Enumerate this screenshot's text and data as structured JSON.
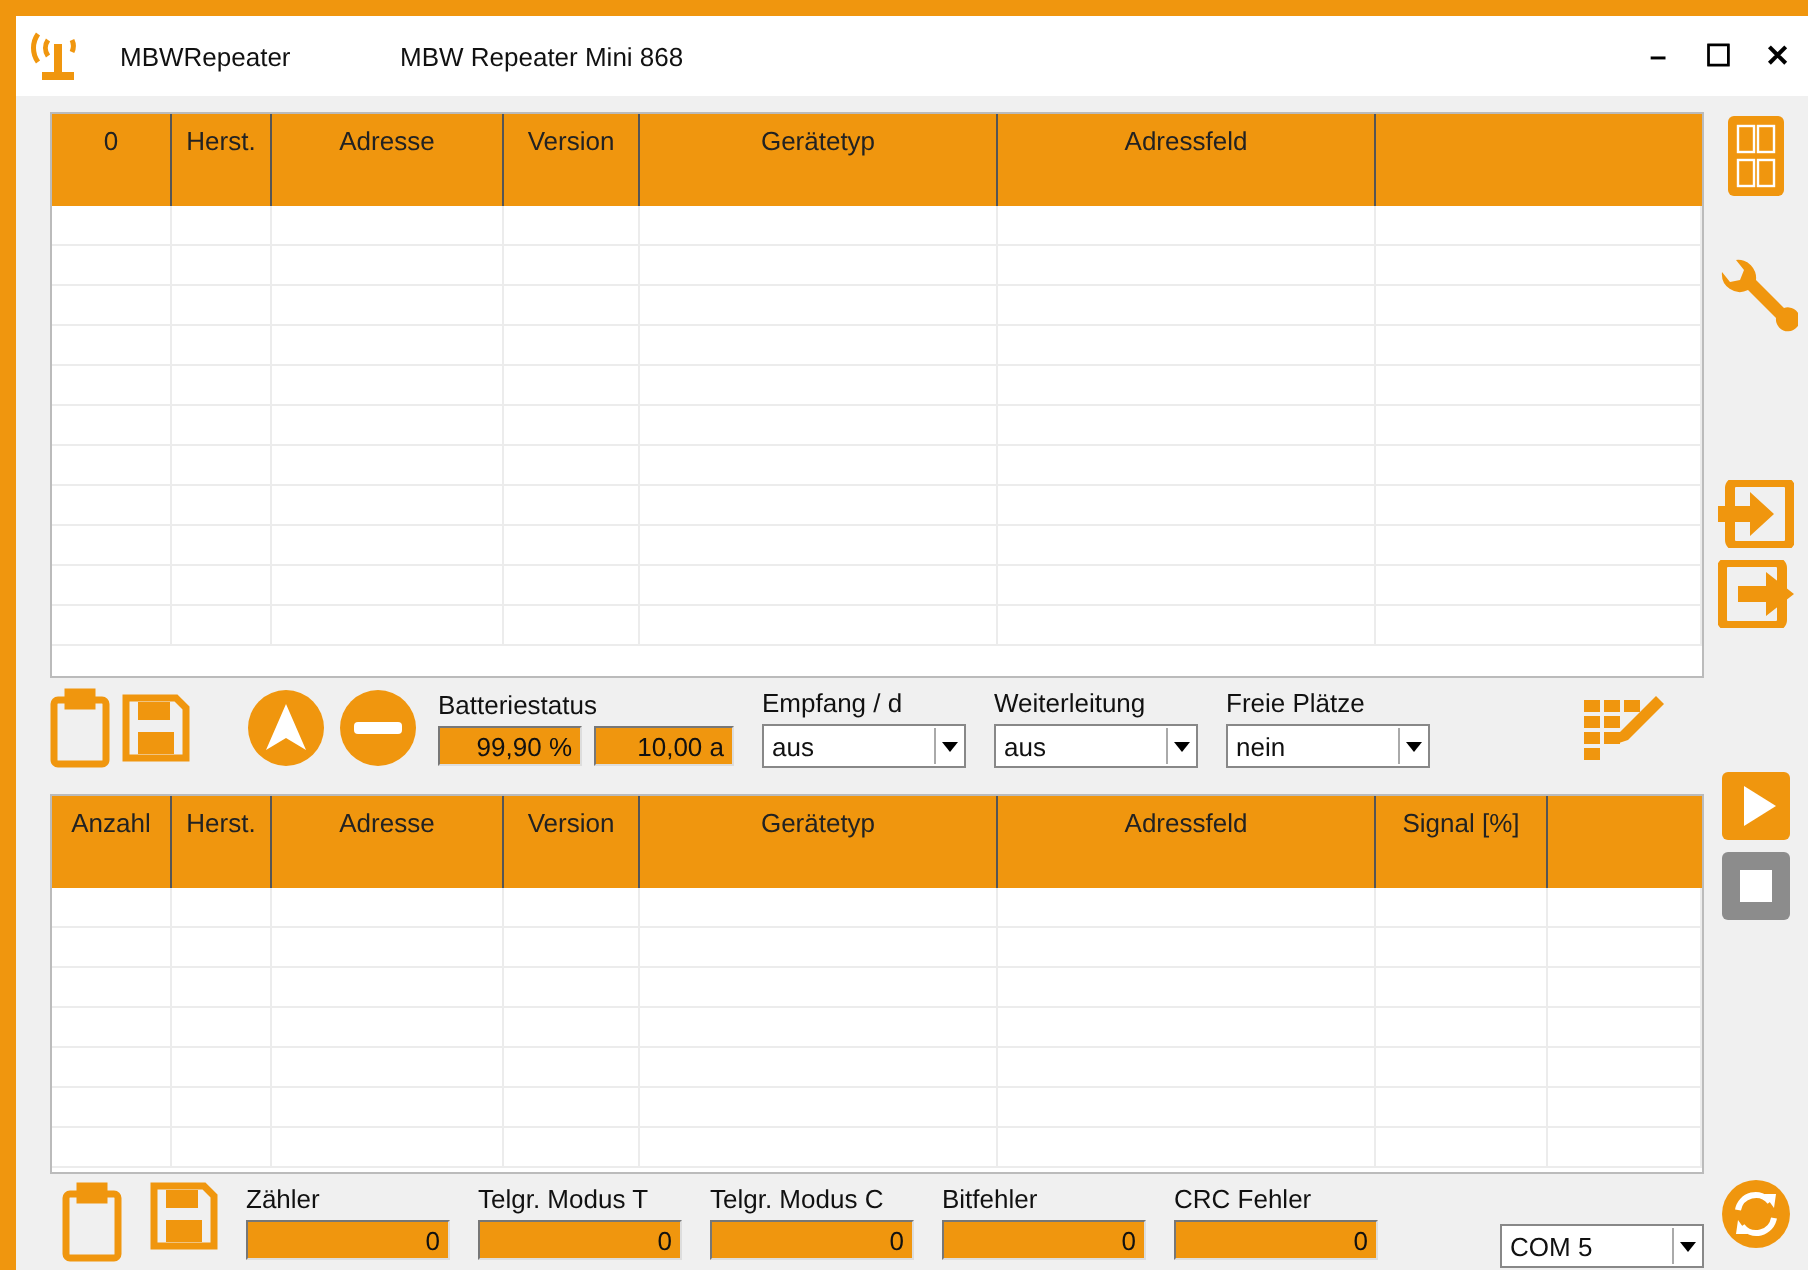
{
  "window": {
    "app_name": "MBWRepeater",
    "title": "MBW Repeater Mini 868",
    "controls": [
      "–",
      "☐",
      "✕"
    ]
  },
  "device_table": {
    "columns": [
      "0",
      "Herst.",
      "Adresse",
      "Version",
      "Gerätetyp",
      "Adressfeld"
    ]
  },
  "toolbar": {
    "battery": {
      "label": "Batteriestatus",
      "percent": "99,90 %",
      "years": "10,00 a"
    },
    "dropdowns": [
      {
        "label": "Empfang / d",
        "value": "aus"
      },
      {
        "label": "Weiterleitung",
        "value": "aus"
      },
      {
        "label": "Freie Plätze",
        "value": "nein"
      }
    ]
  },
  "received_table": {
    "columns": [
      "Anzahl",
      "Herst.",
      "Adresse",
      "Version",
      "Gerätetyp",
      "Adressfeld",
      "Signal [%]"
    ]
  },
  "counters": [
    {
      "label": "Zähler",
      "value": "0"
    },
    {
      "label": "Telgr. Modus T",
      "value": "0"
    },
    {
      "label": "Telgr. Modus C",
      "value": "0"
    },
    {
      "label": "Bitfehler",
      "value": "0"
    },
    {
      "label": "CRC Fehler",
      "value": "0"
    }
  ],
  "port": {
    "value": "COM 5"
  },
  "sidebar": [
    {
      "kind": "layout",
      "disabled": false
    },
    {
      "kind": "wrench",
      "disabled": false
    },
    {
      "kind": "gap"
    },
    {
      "kind": "import",
      "disabled": false
    },
    {
      "kind": "export",
      "disabled": false
    },
    {
      "kind": "gap"
    },
    {
      "kind": "play",
      "disabled": false
    },
    {
      "kind": "stop",
      "disabled": true
    }
  ]
}
